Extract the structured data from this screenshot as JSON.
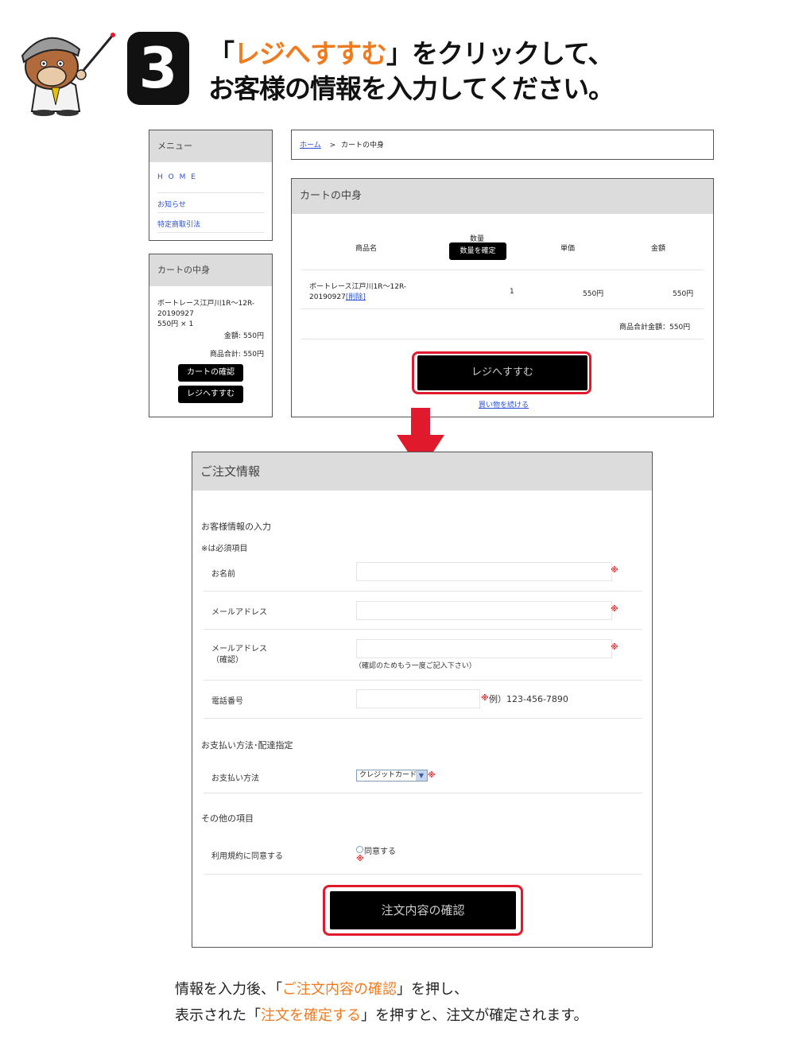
{
  "colors": {
    "accent_orange": "#f07a1e",
    "highlight_red": "#e0192c",
    "arrow_red": "#e0192c",
    "panel_header_gray": "#dcdcdc"
  },
  "header": {
    "step_number": "3",
    "line1_open": "「",
    "line1_highlight": "レジへすすむ",
    "line1_close": "」をクリックして、",
    "line2": "お客様の情報を入力してください。"
  },
  "menu": {
    "title": "メニュー",
    "items": [
      "H O M E",
      "お知らせ",
      "特定商取引法"
    ]
  },
  "mini_cart": {
    "title": "カートの中身",
    "item_name_line1": "ボートレース江戸川1R～12R-",
    "item_name_line2": "20190927",
    "item_qty": "550円 × 1",
    "item_amount": "金額: 550円",
    "subtotal": "商品合計: 550円",
    "btn_confirm_cart": "カートの確認",
    "btn_checkout": "レジへすすむ"
  },
  "breadcrumb": {
    "home": "ホーム",
    "separator": ">",
    "current": "カートの中身"
  },
  "cart": {
    "title": "カートの中身",
    "col_name": "商品名",
    "col_qty": "数量",
    "btn_update_qty": "数量を確定",
    "col_unit_price": "単価",
    "col_amount": "金額",
    "row": {
      "name_line1": "ボートレース江戸川1R～12R-",
      "name_line2": "20190927",
      "delete": "[削除]",
      "qty": "1",
      "unit_price": "550円",
      "amount": "550円"
    },
    "total": "商品合計金額：550円",
    "btn_checkout": "レジへすすむ",
    "continue_shopping": "買い物を続ける"
  },
  "order": {
    "title": "ご注文情報",
    "section_customer": "お客様情報の入力",
    "required_note": "※は必須項目",
    "field_name": "お名前",
    "field_email": "メールアドレス",
    "field_email_confirm_1": "メールアドレス",
    "field_email_confirm_2": "（確認）",
    "email_confirm_hint": "（確認のためもう一度ご記入下さい）",
    "field_phone": "電話番号",
    "phone_example": "例）123-456-7890",
    "required_mark": "※",
    "section_payment": "お支払い方法･配達指定",
    "field_payment": "お支払い方法",
    "payment_selected": "クレジットカード",
    "section_other": "その他の項目",
    "field_terms": "利用規約に同意する",
    "terms_option": "同意する",
    "btn_confirm": "注文内容の確認"
  },
  "footer": {
    "line1_a": "情報を入力後、「",
    "line1_highlight": "ご注文内容の確認",
    "line1_b": "」を押し、",
    "line2_a": "表示された「",
    "line2_highlight": "注文を確定する",
    "line2_b": "」を押すと、注文が確定されます。"
  }
}
